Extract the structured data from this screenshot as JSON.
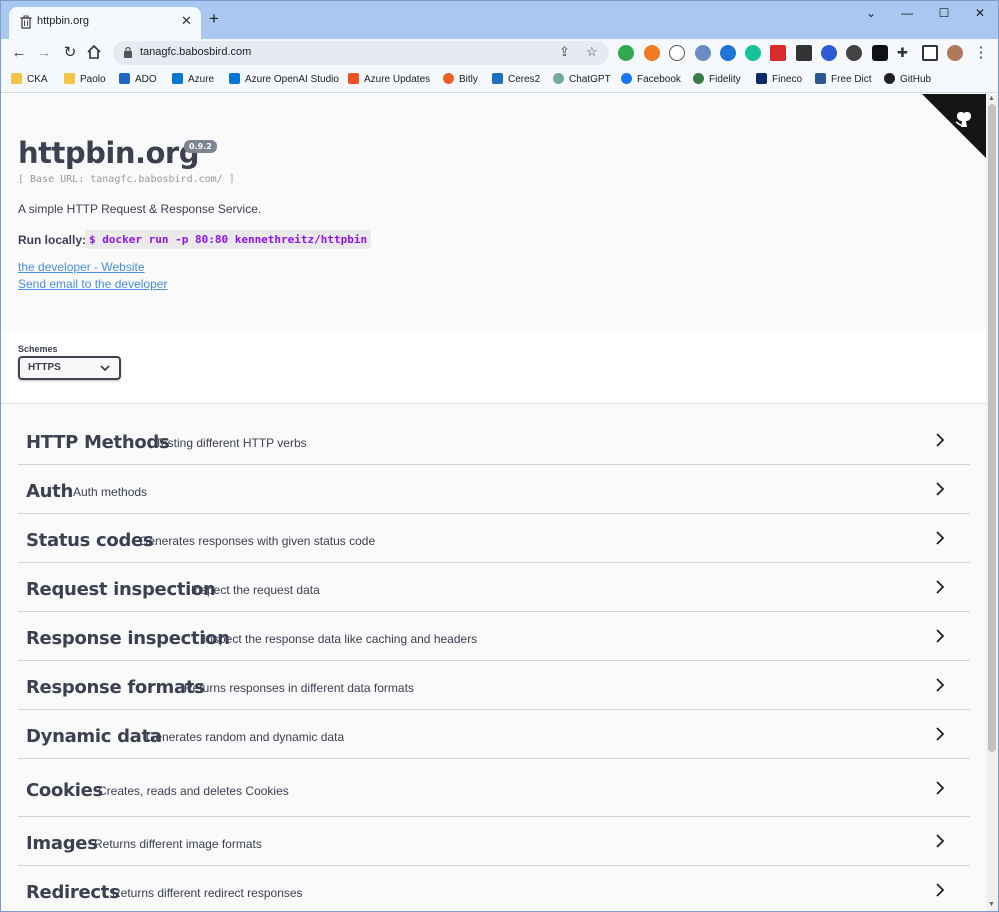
{
  "browser": {
    "tab_title": "httpbin.org",
    "url": "tanagfc.babosbird.com",
    "bookmarks": [
      "CKA",
      "Paolo",
      "ADO",
      "Azure",
      "Azure OpenAI Studio",
      "Azure Updates",
      "Bitly",
      "Ceres2",
      "ChatGPT",
      "Facebook",
      "Fidelity",
      "Fineco",
      "Free Dict",
      "GitHub"
    ]
  },
  "info": {
    "title": "httpbin.org",
    "version": "0.9.2",
    "base_url": "[ Base URL: tanagfc.babosbird.com/ ]",
    "description": "A simple HTTP Request & Response Service.",
    "run_label": "Run locally:",
    "run_command": "$ docker run -p 80:80 kennethreitz/httpbin",
    "link_website": "the developer - Website",
    "link_email": "Send email to the developer"
  },
  "schemes": {
    "label": "Schemes",
    "selected": "HTTPS"
  },
  "operations": [
    {
      "name": "HTTP Methods",
      "description": "Testing different HTTP verbs"
    },
    {
      "name": "Auth",
      "description": "Auth methods"
    },
    {
      "name": "Status codes",
      "description": "Generates responses with given status code"
    },
    {
      "name": "Request inspection",
      "description": "Inspect the request data"
    },
    {
      "name": "Response inspection",
      "description": "Inspect the response data like caching and headers"
    },
    {
      "name": "Response formats",
      "description": "Returns responses in different data formats"
    },
    {
      "name": "Dynamic data",
      "description": "Generates random and dynamic data"
    },
    {
      "name": "Cookies",
      "description": "Creates, reads and deletes Cookies"
    },
    {
      "name": "Images",
      "description": "Returns different image formats"
    },
    {
      "name": "Redirects",
      "description": "Returns different redirect responses"
    }
  ],
  "colors": {
    "accent_link": "#4990e2",
    "command_text": "#9012fe",
    "heading": "#3b4151"
  }
}
